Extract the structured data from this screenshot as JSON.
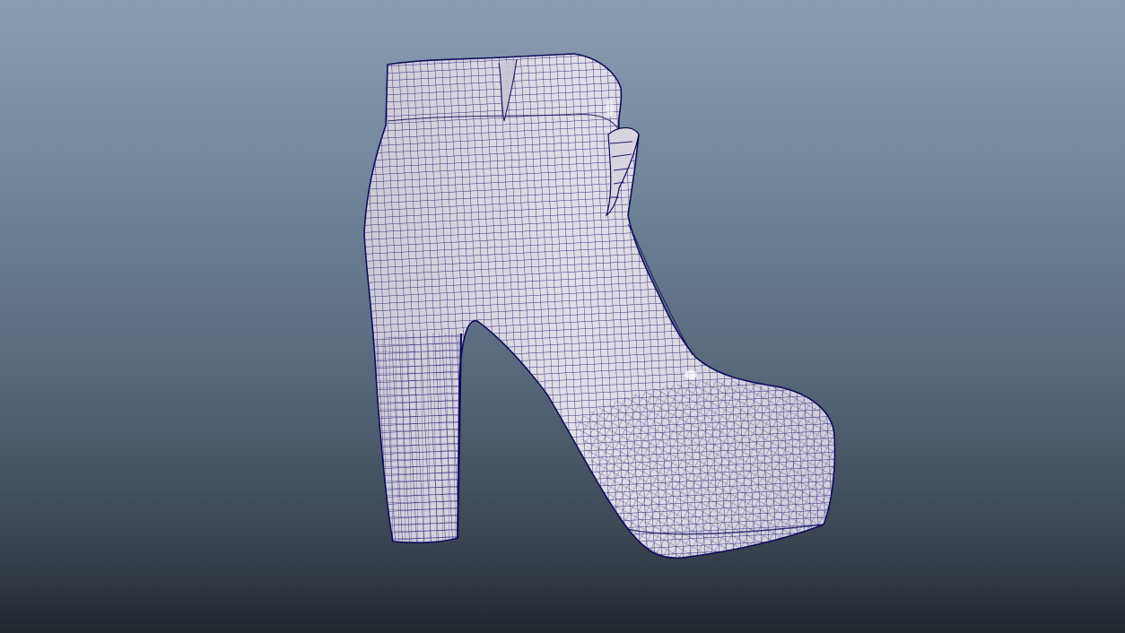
{
  "viewport": {
    "background_top": "#8a9db3",
    "background_bottom": "#22272e"
  },
  "model": {
    "shading": "wireframe-on-shaded",
    "surface_color": "#d9d6de",
    "wire_color": "#1c1a7a",
    "outline_color": "#0d0b5c"
  }
}
